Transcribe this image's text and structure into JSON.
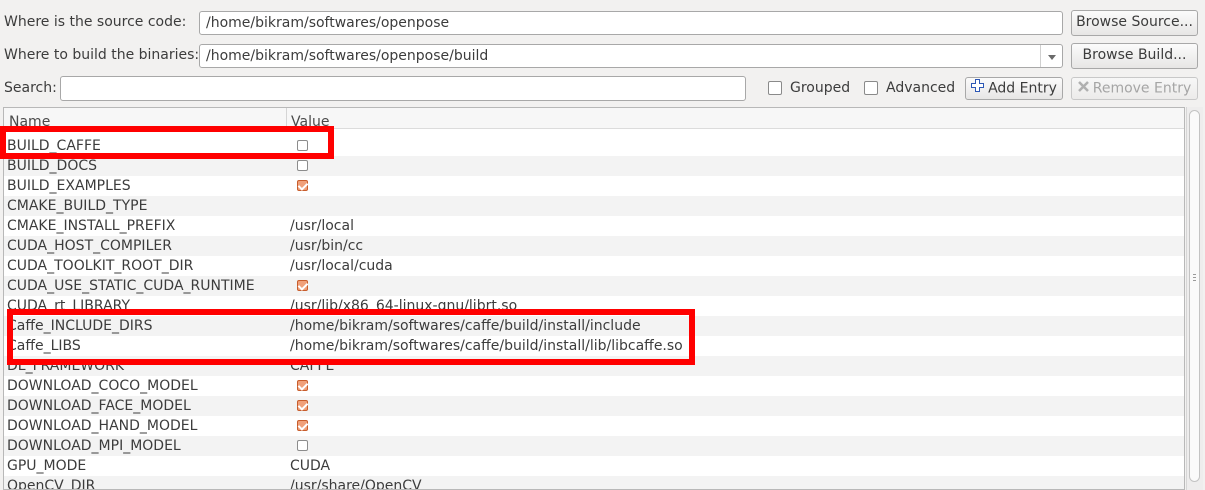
{
  "source": {
    "label": "Where is the source code:",
    "value": "/home/bikram/softwares/openpose",
    "browse_label": "Browse Source..."
  },
  "build": {
    "label": "Where to build the binaries:",
    "value": "/home/bikram/softwares/openpose/build",
    "browse_label": "Browse Build..."
  },
  "search": {
    "label": "Search:",
    "value": ""
  },
  "options": {
    "grouped_label": "Grouped",
    "grouped_checked": false,
    "advanced_label": "Advanced",
    "advanced_checked": false
  },
  "toolbar": {
    "add_entry_label": "Add Entry",
    "add_entry_icon": "plus-icon",
    "remove_entry_label": "Remove Entry",
    "remove_entry_icon": "x-icon"
  },
  "table": {
    "columns": [
      "Name",
      "Value"
    ],
    "rows": [
      {
        "name": "BUILD_CAFFE",
        "type": "bool",
        "checked": false
      },
      {
        "name": "BUILD_DOCS",
        "type": "bool",
        "checked": false
      },
      {
        "name": "BUILD_EXAMPLES",
        "type": "bool",
        "checked": true
      },
      {
        "name": "CMAKE_BUILD_TYPE",
        "type": "text",
        "value": ""
      },
      {
        "name": "CMAKE_INSTALL_PREFIX",
        "type": "text",
        "value": "/usr/local"
      },
      {
        "name": "CUDA_HOST_COMPILER",
        "type": "text",
        "value": "/usr/bin/cc"
      },
      {
        "name": "CUDA_TOOLKIT_ROOT_DIR",
        "type": "text",
        "value": "/usr/local/cuda"
      },
      {
        "name": "CUDA_USE_STATIC_CUDA_RUNTIME",
        "type": "bool",
        "checked": true
      },
      {
        "name": "CUDA_rt_LIBRARY",
        "type": "text",
        "value": "/usr/lib/x86_64-linux-gnu/librt.so"
      },
      {
        "name": "Caffe_INCLUDE_DIRS",
        "type": "text",
        "value": "/home/bikram/softwares/caffe/build/install/include"
      },
      {
        "name": "Caffe_LIBS",
        "type": "text",
        "value": "/home/bikram/softwares/caffe/build/install/lib/libcaffe.so"
      },
      {
        "name": "DL_FRAMEWORK",
        "type": "text",
        "value": "CAFFE"
      },
      {
        "name": "DOWNLOAD_COCO_MODEL",
        "type": "bool",
        "checked": true
      },
      {
        "name": "DOWNLOAD_FACE_MODEL",
        "type": "bool",
        "checked": true
      },
      {
        "name": "DOWNLOAD_HAND_MODEL",
        "type": "bool",
        "checked": true
      },
      {
        "name": "DOWNLOAD_MPI_MODEL",
        "type": "bool",
        "checked": false
      },
      {
        "name": "GPU_MODE",
        "type": "text",
        "value": "CUDA"
      },
      {
        "name": "OpenCV_DIR",
        "type": "text",
        "value": "/usr/share/OpenCV"
      }
    ]
  },
  "colors": {
    "highlight": "#ff0000",
    "checkbox_checked": "#f0a07a"
  }
}
